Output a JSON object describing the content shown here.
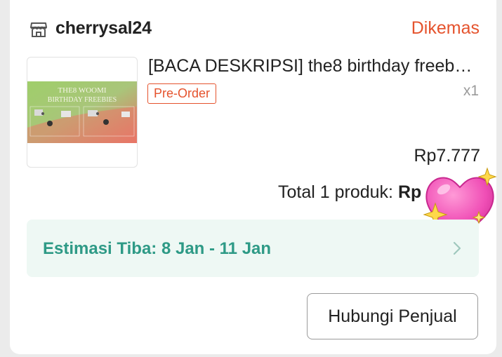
{
  "shop": {
    "name": "cherrysal24",
    "status": "Dikemas"
  },
  "product": {
    "title": "[BACA DESKRIPSI] the8 birthday freeb…",
    "tag": "Pre-Order",
    "quantity": "x1",
    "price": "Rp7.777",
    "image": {
      "title_line1": "THE8 WOOMI",
      "title_line2": "BIRTHDAY FREEBIES"
    }
  },
  "summary": {
    "total_label": "Total 1 produk: ",
    "total_value": "Rp"
  },
  "delivery": {
    "eta": "Estimasi Tiba: 8 Jan - 11 Jan"
  },
  "actions": {
    "contact_seller": "Hubungi Penjual"
  },
  "colors": {
    "accent": "#e5532d",
    "eta_text": "#2e9a86",
    "eta_bg": "#eef8f4"
  },
  "icons": {
    "shop": "store-icon",
    "chevron": "chevron-right-icon",
    "sticker": "sparkling-heart-sticker"
  }
}
